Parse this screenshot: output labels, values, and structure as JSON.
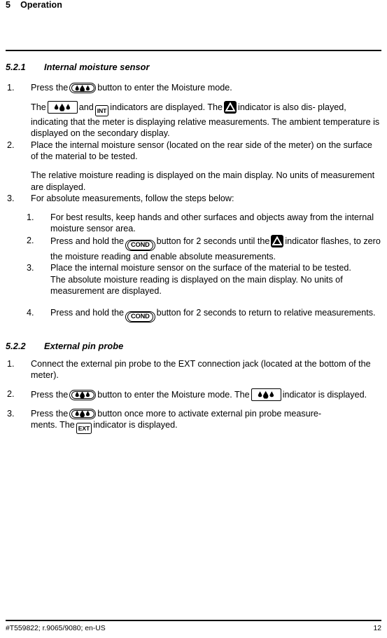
{
  "header": {
    "chapter_number": "5",
    "chapter_title": "Operation"
  },
  "sections": [
    {
      "number": "5.2.1",
      "title": "Internal moisture sensor"
    },
    {
      "number": "5.2.2",
      "title": "External pin probe"
    }
  ],
  "internal_sensor_steps": {
    "step1": {
      "marker": "1.",
      "text_before_icon": "Press the",
      "icon": "moisture-button",
      "text_after_icon": "button to enter the Moisture mode."
    },
    "step1_note": {
      "t1": "The",
      "icon1": "moisture-indicator",
      "t2": "and",
      "icon2": "int-indicator",
      "t3": "indicators are displayed. The",
      "icon3": "delta-indicator",
      "t4": "indicator is also dis-",
      "t5": "played, indicating that the meter is displaying relative measurements. The",
      "t6": "ambient temperature is displayed on the secondary display."
    },
    "step2": {
      "marker": "2.",
      "text": "Place the internal moisture sensor (located on the rear side of the meter) on the surface of the material to be tested."
    },
    "step2_note": {
      "text": "The relative moisture reading is displayed on the main display. No units of measurement are displayed."
    },
    "step3": {
      "marker": "3.",
      "text": "For absolute measurements, follow the steps below:"
    }
  },
  "absolute_substeps": [
    {
      "marker": "1.",
      "text": "For best results, keep hands and other surfaces and objects away from the internal moisture sensor area."
    },
    {
      "marker": "2.",
      "t1": "Press and hold the",
      "icon1": "cond-button",
      "t2": "button for 2 seconds until the",
      "icon2": "delta-indicator",
      "t3": "indicator flashes, to zero the moisture reading and enable absolute measurements."
    },
    {
      "marker": "3.",
      "text": "Place the internal moisture sensor on the surface of the material to be tested.",
      "note": "The absolute moisture reading is displayed on the main display. No units of measurement are displayed."
    },
    {
      "marker": "4.",
      "t1": "Press and hold the",
      "icon1": "cond-button",
      "t2": "button for 2 seconds to return to relative measurements."
    }
  ],
  "external_probe_steps": {
    "step1": {
      "marker": "1.",
      "text": "Connect the external pin probe to the EXT connection jack (located at the bottom of the meter)."
    },
    "step2": {
      "marker": "2.",
      "t1": "Press the",
      "icon1": "moisture-button",
      "t2": "button to enter the Moisture mode. The",
      "icon2": "moisture-indicator",
      "t3": "indicator is displayed."
    },
    "step3": {
      "marker": "3.",
      "t1": "Press the",
      "icon1": "moisture-button",
      "t2": "button once more to activate external pin probe measure-",
      "t3": "ments. The",
      "icon2": "ext-indicator",
      "t4": "indicator is displayed."
    }
  },
  "icon_labels": {
    "cond": "COND",
    "int": "INT",
    "ext": "EXT"
  },
  "footer": {
    "doc_id": "#T559822; r.9065/9080; en-US",
    "page_number": "12"
  },
  "colors": {
    "text": "#000000",
    "background": "#ffffff"
  }
}
